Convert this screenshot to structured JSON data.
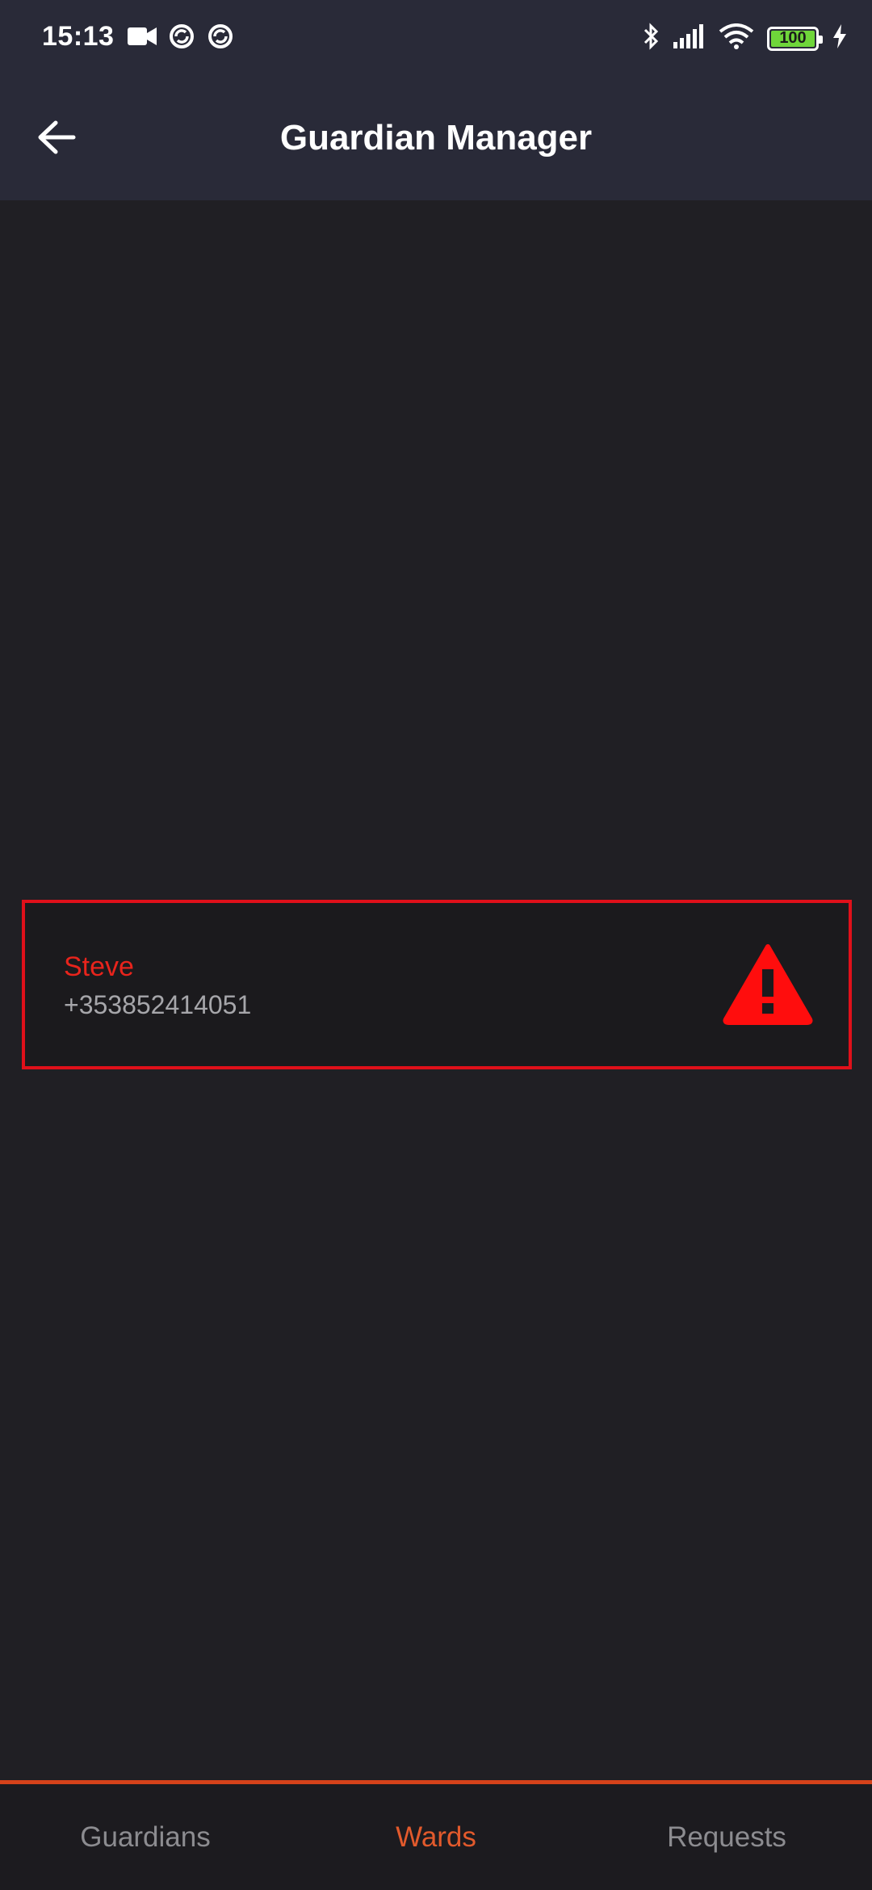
{
  "status_bar": {
    "time": "15:13",
    "left_icons": [
      "video-camera-icon",
      "sync-icon",
      "sync-icon"
    ],
    "right_icons": [
      "bluetooth-icon",
      "signal-icon",
      "wifi-icon",
      "battery-icon",
      "charging-icon"
    ],
    "battery_level": "100",
    "battery_color": "#6fd63a"
  },
  "app_bar": {
    "back_icon": "arrow-left-icon",
    "title": "Guardian Manager",
    "background": "#292a38"
  },
  "wards": [
    {
      "name": "Steve",
      "phone": "+353852414051",
      "status_icon": "warning-triangle-icon",
      "alert_color": "#e0101a"
    }
  ],
  "bottom_nav": {
    "tabs": [
      {
        "label": "Guardians",
        "active": false
      },
      {
        "label": "Wards",
        "active": true
      },
      {
        "label": "Requests",
        "active": false
      }
    ],
    "accent_color": "#e25a2c"
  }
}
